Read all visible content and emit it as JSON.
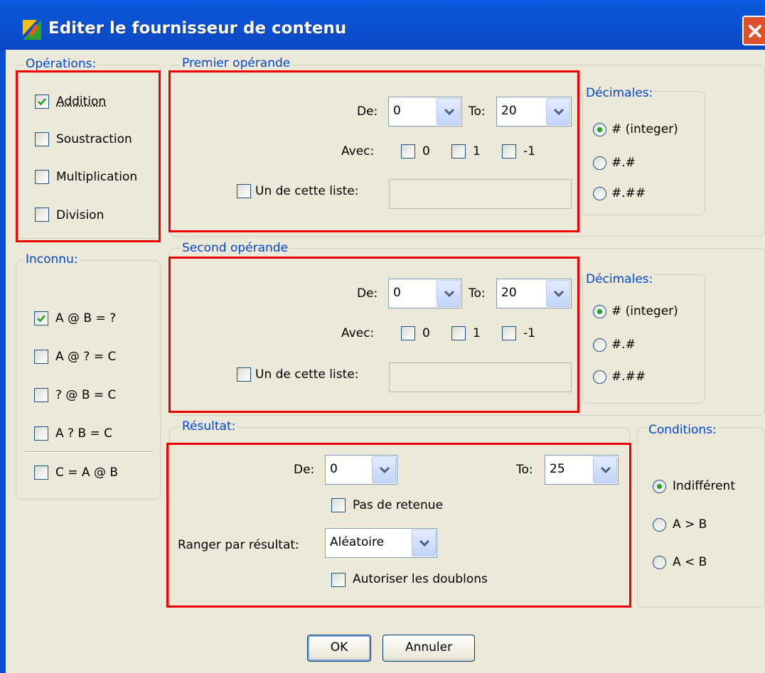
{
  "window": {
    "title": "Editer le fournisseur de contenu",
    "icon": "app-icon",
    "close_icon": "close-icon"
  },
  "operations": {
    "title": "Opérations:",
    "items": [
      {
        "label": "Addition",
        "checked": true
      },
      {
        "label": "Soustraction",
        "checked": false
      },
      {
        "label": "Multiplication",
        "checked": false
      },
      {
        "label": "Division",
        "checked": false
      }
    ]
  },
  "unknown": {
    "title": "Inconnu:",
    "items": [
      {
        "label": "A @ B = ?",
        "checked": true
      },
      {
        "label": "A @ ? = C",
        "checked": false
      },
      {
        "label": "? @ B = C",
        "checked": false
      },
      {
        "label": "A ? B = C",
        "checked": false
      },
      {
        "label": "C = A @ B",
        "checked": false
      }
    ]
  },
  "first_operand": {
    "title": "Premier opérande",
    "from_label": "De:",
    "from_value": "0",
    "to_label": "To:",
    "to_value": "20",
    "with_label": "Avec:",
    "with_options": [
      "0",
      "1",
      "-1"
    ],
    "list_label": "Un de cette liste:",
    "list_value": ""
  },
  "first_decimals": {
    "title": "Décimales:",
    "options": [
      "# (integer)",
      "#.#",
      "#.##"
    ],
    "selected": "# (integer)"
  },
  "second_operand": {
    "title": "Second opérande",
    "from_label": "De:",
    "from_value": "0",
    "to_label": "To:",
    "to_value": "20",
    "with_label": "Avec:",
    "with_options": [
      "0",
      "1",
      "-1"
    ],
    "list_label": "Un de cette liste:",
    "list_value": ""
  },
  "second_decimals": {
    "title": "Décimales:",
    "options": [
      "# (integer)",
      "#.#",
      "#.##"
    ],
    "selected": "# (integer)"
  },
  "result": {
    "title": "Résultat:",
    "from_label": "De:",
    "from_value": "0",
    "to_label": "To:",
    "to_value": "25",
    "no_carry_label": "Pas de retenue",
    "sort_label": "Ranger par résultat:",
    "sort_value": "Aléatoire",
    "allow_duplicates_label": "Autoriser les doublons"
  },
  "conditions": {
    "title": "Conditions:",
    "options": [
      "Indifférent",
      "A > B",
      "A < B"
    ],
    "selected": "Indifférent"
  },
  "buttons": {
    "ok": "OK",
    "cancel": "Annuler"
  },
  "colors": {
    "title_bar": "#0a4fd0",
    "group_title": "#0046d5",
    "highlight": "#f00000",
    "dialog_bg": "#ece9d8",
    "check": "#21a121"
  }
}
